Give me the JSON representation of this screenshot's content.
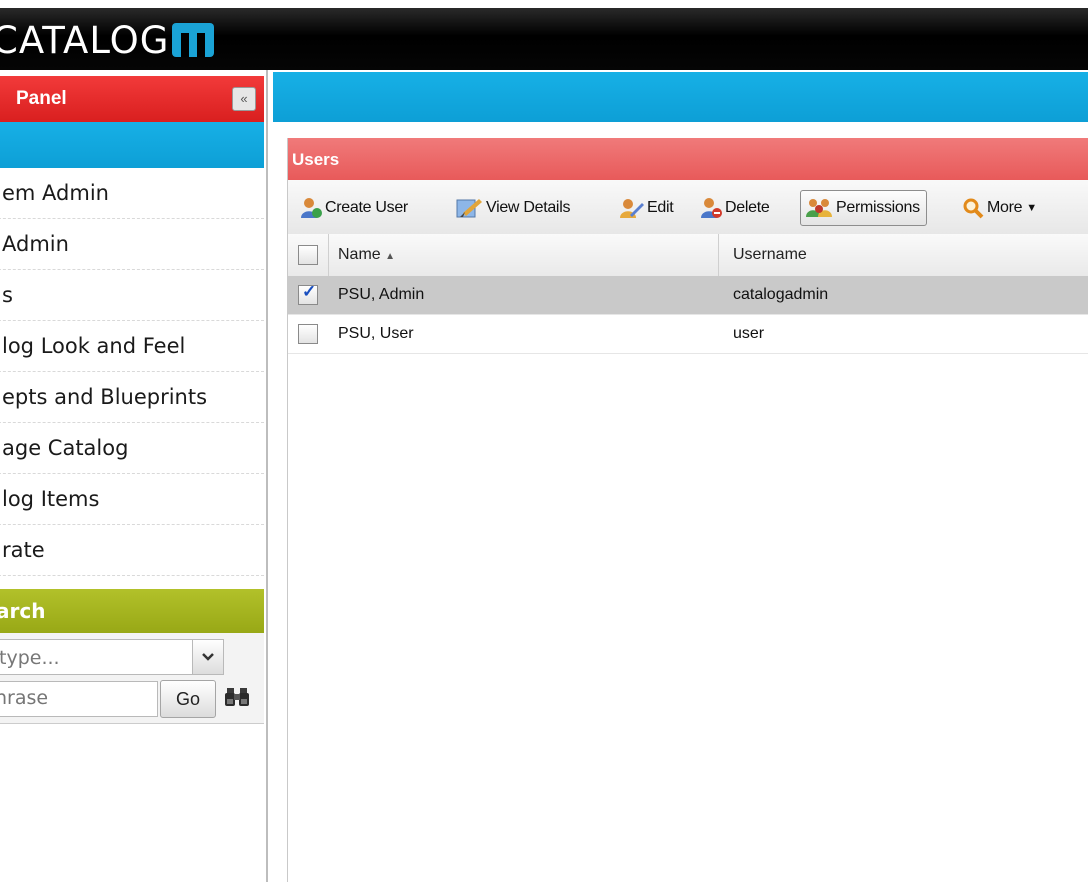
{
  "app": {
    "logo_text": "CATALOG",
    "logo_mark": "m"
  },
  "left_panel": {
    "title": "Panel",
    "collapse_icon": "double-chevron-left-icon",
    "nav_items": [
      {
        "label": "em Admin"
      },
      {
        "label": "Admin"
      },
      {
        "label": "s"
      },
      {
        "label": "log Look and Feel"
      },
      {
        "label": "epts and Blueprints"
      },
      {
        "label": "age Catalog"
      },
      {
        "label": "log Items"
      },
      {
        "label": "rate"
      }
    ],
    "search": {
      "title": "arch",
      "type_placeholder": "type...",
      "phrase_placeholder": "hrase",
      "go_label": "Go"
    }
  },
  "users_panel": {
    "title": "Users",
    "toolbar": {
      "create_user": "Create User",
      "view_details": "View Details",
      "edit": "Edit",
      "delete": "Delete",
      "permissions": "Permissions",
      "more": "More"
    },
    "columns": {
      "name": "Name",
      "username": "Username"
    },
    "rows": [
      {
        "name": "PSU, Admin",
        "username": "catalogadmin",
        "checked": true
      },
      {
        "name": "PSU, User",
        "username": "user",
        "checked": false
      }
    ]
  },
  "colors": {
    "panel_red": "#e52a2a",
    "accent_blue": "#12a8e0",
    "search_green": "#a8b823",
    "users_header": "#ec6b6b"
  }
}
